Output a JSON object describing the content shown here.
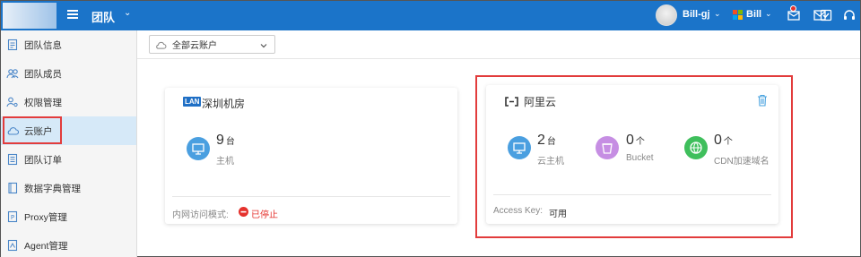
{
  "topbar": {
    "team_label": "团队",
    "team_caret": "⌄",
    "user_name": "Bill-gj",
    "user_caret": "⌄",
    "org_name": "Bill",
    "org_caret": "⌄",
    "brand_color": "#1b74c9"
  },
  "sidebar": {
    "items": [
      {
        "label": "团队信息",
        "icon": "document-icon"
      },
      {
        "label": "团队成员",
        "icon": "users-icon"
      },
      {
        "label": "权限管理",
        "icon": "user-key-icon"
      },
      {
        "label": "云账户",
        "icon": "cloud-icon",
        "active": true
      },
      {
        "label": "团队订单",
        "icon": "order-icon"
      },
      {
        "label": "数据字典管理",
        "icon": "book-icon"
      },
      {
        "label": "Proxy管理",
        "icon": "proxy-icon"
      },
      {
        "label": "Agent管理",
        "icon": "agent-icon"
      }
    ]
  },
  "filter": {
    "label": "全部云账户",
    "icon": "cloud-icon"
  },
  "cards": {
    "lan": {
      "badge": "LAN",
      "title": "深圳机房",
      "host_count": "9",
      "host_unit": "台",
      "host_label": "主机",
      "footer_label": "内网访问模式:",
      "footer_status": "已停止",
      "status_color": "#e5322d"
    },
    "aliyun": {
      "title": "阿里云",
      "host_count": "2",
      "host_unit": "台",
      "host_label": "云主机",
      "bucket_count": "0",
      "bucket_unit": "个",
      "bucket_label": "Bucket",
      "cdn_count": "0",
      "cdn_unit": "个",
      "cdn_label": "CDN加速域名",
      "footer_label": "Access Key:",
      "footer_value": "可用"
    }
  },
  "colors": {
    "host_circle": "#4a9fe0",
    "bucket_circle": "#c68ee3",
    "cdn_circle": "#3fbf5c",
    "highlight": "#e23c3c"
  }
}
